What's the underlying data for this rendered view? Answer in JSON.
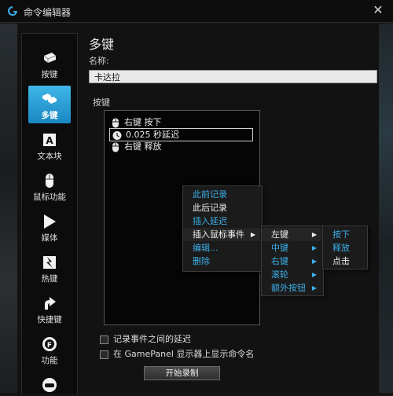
{
  "window": {
    "title": "命令编辑器"
  },
  "sidebar": {
    "items": [
      {
        "label": "按键",
        "icon": "keycap-icon"
      },
      {
        "label": "多键",
        "icon": "multikey-icon",
        "active": true
      },
      {
        "label": "文本块",
        "icon": "text-block-icon"
      },
      {
        "label": "鼠标功能",
        "icon": "mouse-icon"
      },
      {
        "label": "媒体",
        "icon": "play-icon"
      },
      {
        "label": "热键",
        "icon": "hotkey-icon"
      },
      {
        "label": "快捷键",
        "icon": "shortcut-arrow-icon"
      },
      {
        "label": "功能",
        "icon": "function-icon"
      }
    ]
  },
  "main": {
    "heading": "多键",
    "name_label": "名称:",
    "name_value": "卡达拉",
    "keys_label": "按键",
    "key_events": [
      {
        "icon": "mouse-icon",
        "text": "右键 按下"
      },
      {
        "icon": "clock-icon",
        "text": "0.025 秒延迟",
        "selected": true
      },
      {
        "icon": "mouse-icon",
        "text": "右键 释放"
      }
    ],
    "record_delay_label": "记录事件之间的延迟",
    "gamepanel_label": "在 GamePanel 显示器上显示命令名",
    "record_button": "开始录制"
  },
  "context_menu": {
    "items": [
      {
        "label": "此前记录",
        "color": "blue"
      },
      {
        "label": "此后记录",
        "color": "white"
      },
      {
        "label": "插入延迟",
        "color": "blue"
      },
      {
        "label": "插入鼠标事件",
        "color": "white",
        "submenu": true
      },
      {
        "label": "编辑...",
        "color": "blue"
      },
      {
        "label": "删除",
        "color": "blue"
      }
    ]
  },
  "mouse_event_menu": {
    "items": [
      {
        "label": "左键",
        "color": "white",
        "submenu": true
      },
      {
        "label": "中键",
        "color": "blue",
        "submenu": true
      },
      {
        "label": "右键",
        "color": "blue",
        "submenu": true
      },
      {
        "label": "滚轮",
        "color": "blue",
        "submenu": true
      },
      {
        "label": "额外按钮",
        "color": "blue",
        "submenu": true
      }
    ]
  },
  "left_button_menu": {
    "items": [
      {
        "label": "按下",
        "color": "blue"
      },
      {
        "label": "释放",
        "color": "blue"
      },
      {
        "label": "点击",
        "color": "white"
      }
    ]
  },
  "colors": {
    "accent": "#3cb0ea",
    "active_tab": "#2a9fd6"
  }
}
